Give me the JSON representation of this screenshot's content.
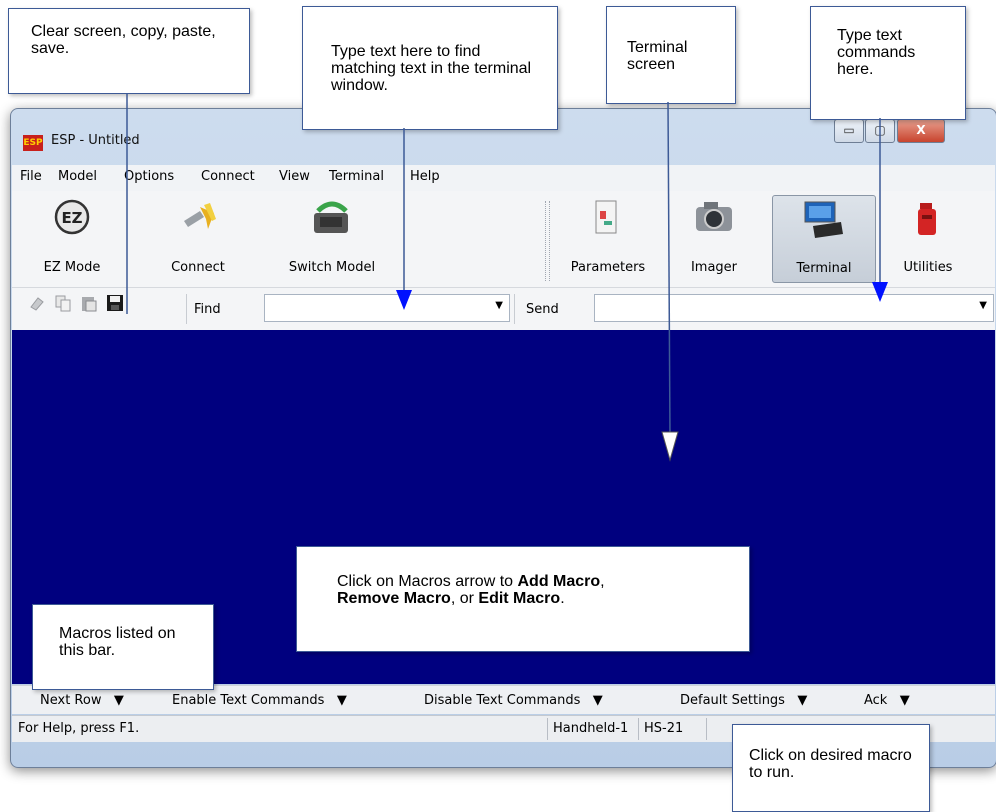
{
  "window": {
    "title": "ESP - Untitled",
    "controls": {
      "minimize": "▭",
      "maximize": "▢",
      "close": "X"
    }
  },
  "menu": [
    "File",
    "Model",
    "Options",
    "Connect",
    "View",
    "Terminal",
    "Help"
  ],
  "toolbar": {
    "left": [
      {
        "label": "EZ Mode",
        "icon": "ez-mode-icon"
      },
      {
        "label": "Connect",
        "icon": "connect-icon"
      },
      {
        "label": "Switch Model",
        "icon": "switch-model-icon"
      }
    ],
    "right": [
      {
        "label": "Parameters",
        "icon": "parameters-icon"
      },
      {
        "label": "Imager",
        "icon": "camera-icon"
      },
      {
        "label": "Terminal",
        "icon": "terminal-icon",
        "active": true
      },
      {
        "label": "Utilities",
        "icon": "utilities-icon"
      }
    ],
    "ez_glyph": "EZ"
  },
  "findrow": {
    "mini_icons": [
      "eraser-icon",
      "copy-icon",
      "paste-icon",
      "save-icon"
    ],
    "find_label": "Find",
    "find_value": "",
    "send_label": "Send",
    "send_value": ""
  },
  "macros": [
    {
      "label": "Next Row"
    },
    {
      "label": "Enable Text Commands"
    },
    {
      "label": "Disable Text Commands"
    },
    {
      "label": "Default Settings"
    },
    {
      "label": "Ack"
    }
  ],
  "macro_arrow": "▼",
  "status": {
    "help": "For Help, press F1.",
    "mode": "Handheld-1",
    "model": "HS-21"
  },
  "callouts": {
    "clear": "Clear screen, copy, paste, save.",
    "find": "Type text here to find matching text in the terminal window.",
    "terminal": "Terminal screen",
    "commands": "Type text commands here.",
    "macros_bar": "Macros listed on this bar.",
    "macros_edit_1": "Click on Macros arrow to ",
    "macros_edit_add": "Add Macro",
    "macros_edit_2": ",",
    "macros_edit_remove": "Remove Macro",
    "macros_edit_3": ", or ",
    "macros_edit_edit": "Edit Macro",
    "macros_edit_4": ".",
    "run": "Click on desired macro to run."
  },
  "colors": {
    "terminal_bg": "#00007f",
    "callout_border": "#3d5a96",
    "close_button": "#c8442e"
  }
}
